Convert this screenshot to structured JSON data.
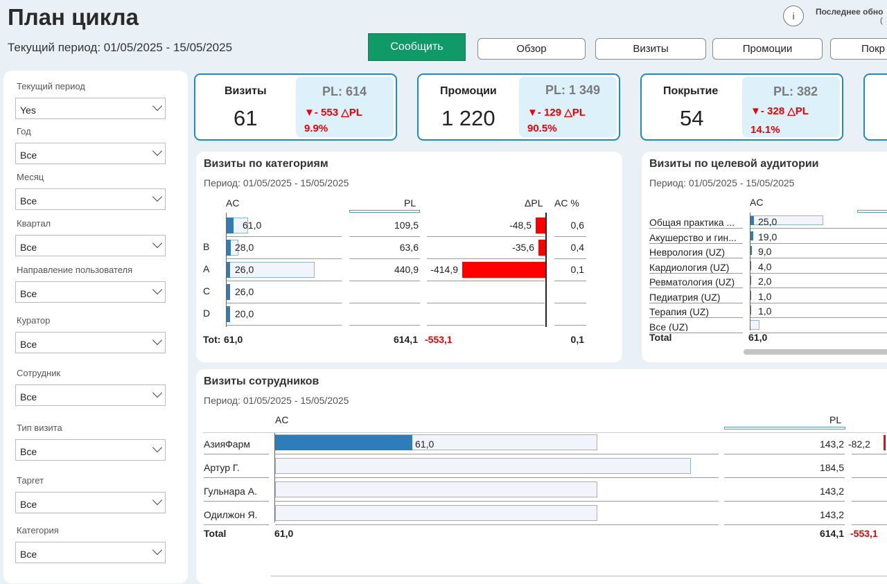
{
  "header": {
    "title": "План цикла",
    "period": "Текущий период: 01/05/2025 - 15/05/2025",
    "info_label": "i",
    "last_update": "Последнее обно",
    "last_update_line2": "("
  },
  "toolbar": {
    "report_label": "Сообщить",
    "tabs": [
      "Обзор",
      "Визиты",
      "Промоции",
      "Покр"
    ]
  },
  "filters": [
    {
      "label": "Текущий период",
      "value": "Yes"
    },
    {
      "label": "Год",
      "value": "Все"
    },
    {
      "label": "Месяц",
      "value": "Все"
    },
    {
      "label": "Квартал",
      "value": "Все"
    },
    {
      "label": "Направление пользователя",
      "value": "Все"
    },
    {
      "label": "Куратор",
      "value": "Все"
    },
    {
      "label": "Сотрудник",
      "value": "Все"
    },
    {
      "label": "Тип визита",
      "value": "Все"
    },
    {
      "label": "Таргет",
      "value": "Все"
    },
    {
      "label": "Категория",
      "value": "Все"
    }
  ],
  "kpis": [
    {
      "title": "Визиты",
      "value": "61",
      "pl": "PL: 614",
      "delta": "▼- 553 △PL",
      "pct": "9.9%"
    },
    {
      "title": "Промоции",
      "value": "1 220",
      "pl": "PL: 1 349",
      "delta": "▼- 129 △PL",
      "pct": "90.5%"
    },
    {
      "title": "Покрытие",
      "value": "54",
      "pl": "PL: 382",
      "delta": "▼- 328 △PL",
      "pct": "14.1%"
    }
  ],
  "categories_card": {
    "title": "Визиты по категориям",
    "period": "Период:  01/05/2025 - 15/05/2025",
    "headers": {
      "ac": "AC",
      "pl": "PL",
      "dpl": "ΔPL",
      "acpct": "AC %"
    },
    "rows": [
      {
        "name": "",
        "ac": 61.0,
        "ac_label": "61,0",
        "pl": 109.5,
        "pl_label": "109,5",
        "dpl": -48.5,
        "dpl_label": "-48,5",
        "acpct": "0,6"
      },
      {
        "name": "B",
        "ac": 28.0,
        "ac_label": "28,0",
        "pl": 63.6,
        "pl_label": "63,6",
        "dpl": -35.6,
        "dpl_label": "-35,6",
        "acpct": "0,4"
      },
      {
        "name": "A",
        "ac": 26.0,
        "ac_label": "26,0",
        "pl": 440.9,
        "pl_label": "440,9",
        "dpl": -414.9,
        "dpl_label": "-414,9",
        "acpct": "0,1"
      },
      {
        "name": "C",
        "ac": 26.0,
        "ac_label": "26,0",
        "pl": null,
        "pl_label": "",
        "dpl": null,
        "dpl_label": "",
        "acpct": ""
      },
      {
        "name": "D",
        "ac": 20.0,
        "ac_label": "20,0",
        "pl": null,
        "pl_label": "",
        "dpl": null,
        "dpl_label": "",
        "acpct": ""
      }
    ],
    "total": {
      "name": "Tot:",
      "ac": "61,0",
      "pl": "614,1",
      "dpl": "-553,1",
      "acpct": "0,1"
    }
  },
  "audience_card": {
    "title": "Визиты по целевой аудитории",
    "period": "Период:  01/05/2025 - 15/05/2025",
    "headers": {
      "ac": "AC"
    },
    "rows": [
      {
        "name": "Общая практика ...",
        "ac": 25.0,
        "ac_label": "25,0",
        "pl": 45
      },
      {
        "name": "Акушерство и гин...",
        "ac": 19.0,
        "ac_label": "19,0",
        "pl": null
      },
      {
        "name": "Неврология (UZ)",
        "ac": 9.0,
        "ac_label": "9,0",
        "pl": null
      },
      {
        "name": "Кардиология (UZ)",
        "ac": 4.0,
        "ac_label": "4,0",
        "pl": null
      },
      {
        "name": "Ревматология (UZ)",
        "ac": 2.0,
        "ac_label": "2,0",
        "pl": null
      },
      {
        "name": "Педиатрия (UZ)",
        "ac": 1.0,
        "ac_label": "1,0",
        "pl": null
      },
      {
        "name": "Терапия (UZ)",
        "ac": 1.0,
        "ac_label": "1,0",
        "pl": null
      },
      {
        "name": "Все (UZ)",
        "ac": null,
        "ac_label": "",
        "pl": 6
      }
    ],
    "total": {
      "name": "Total",
      "ac": "61,0"
    }
  },
  "employees_card": {
    "title": "Визиты сотрудников",
    "period": "Период:  01/05/2025 - 15/05/2025",
    "headers": {
      "ac": "AC",
      "pl": "PL"
    },
    "rows": [
      {
        "name": "АзияФарм",
        "ac": 61.0,
        "ac_label": "61,0",
        "pl": 143.2,
        "pl_label": "143,2",
        "dpl_label": "-82,2"
      },
      {
        "name": "Артур Г.",
        "ac": null,
        "ac_label": "",
        "pl": 184.5,
        "pl_label": "184,5",
        "dpl_label": ""
      },
      {
        "name": "Гульнара А.",
        "ac": null,
        "ac_label": "",
        "pl": 143.2,
        "pl_label": "143,2",
        "dpl_label": ""
      },
      {
        "name": "Одилжон Я.",
        "ac": null,
        "ac_label": "",
        "pl": 143.2,
        "pl_label": "143,2",
        "dpl_label": ""
      }
    ],
    "total": {
      "name": "Total",
      "ac": "61,0",
      "pl": "614,1",
      "dpl": "-553,1"
    }
  },
  "colors": {
    "accent": "#0f9a67",
    "bar": "#2e7cb8",
    "negative": "#ff0000",
    "kpi_border": "#1a8bc9",
    "kpi_box": "#ddf1fb"
  }
}
